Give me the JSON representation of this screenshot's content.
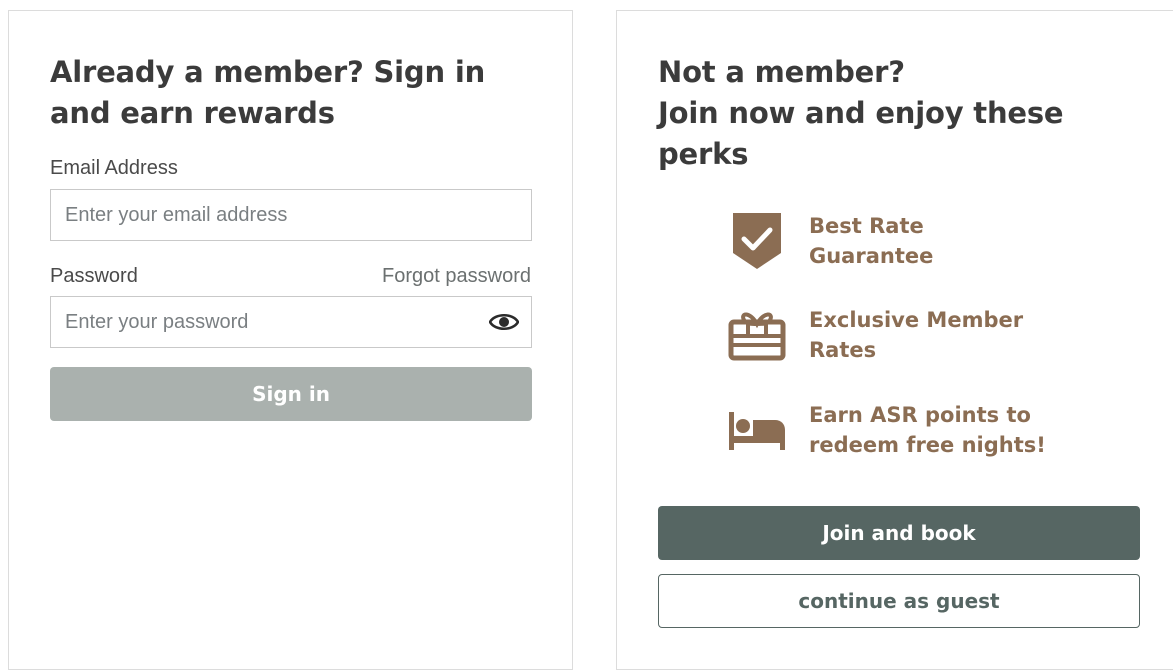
{
  "signin": {
    "title": "Already a member? Sign in and earn rewards",
    "email_label": "Email Address",
    "email_placeholder": "Enter your email address",
    "password_label": "Password",
    "forgot_link": "Forgot password",
    "password_placeholder": "Enter your password",
    "submit_label": "Sign in"
  },
  "join": {
    "title_line1": "Not a member?",
    "title_line2": "Join now and enjoy these perks",
    "perks": [
      {
        "icon": "shield-check-icon",
        "label": "Best Rate Guarantee"
      },
      {
        "icon": "gift-card-icon",
        "label": "Exclusive Member Rates"
      },
      {
        "icon": "bed-icon",
        "label": "Earn ASR points to redeem free nights!"
      }
    ],
    "join_label": "Join and book",
    "guest_label": "continue as guest"
  },
  "colors": {
    "accent_brown": "#8b6d53",
    "primary_button": "#566663",
    "disabled_button": "#aab1ae"
  }
}
